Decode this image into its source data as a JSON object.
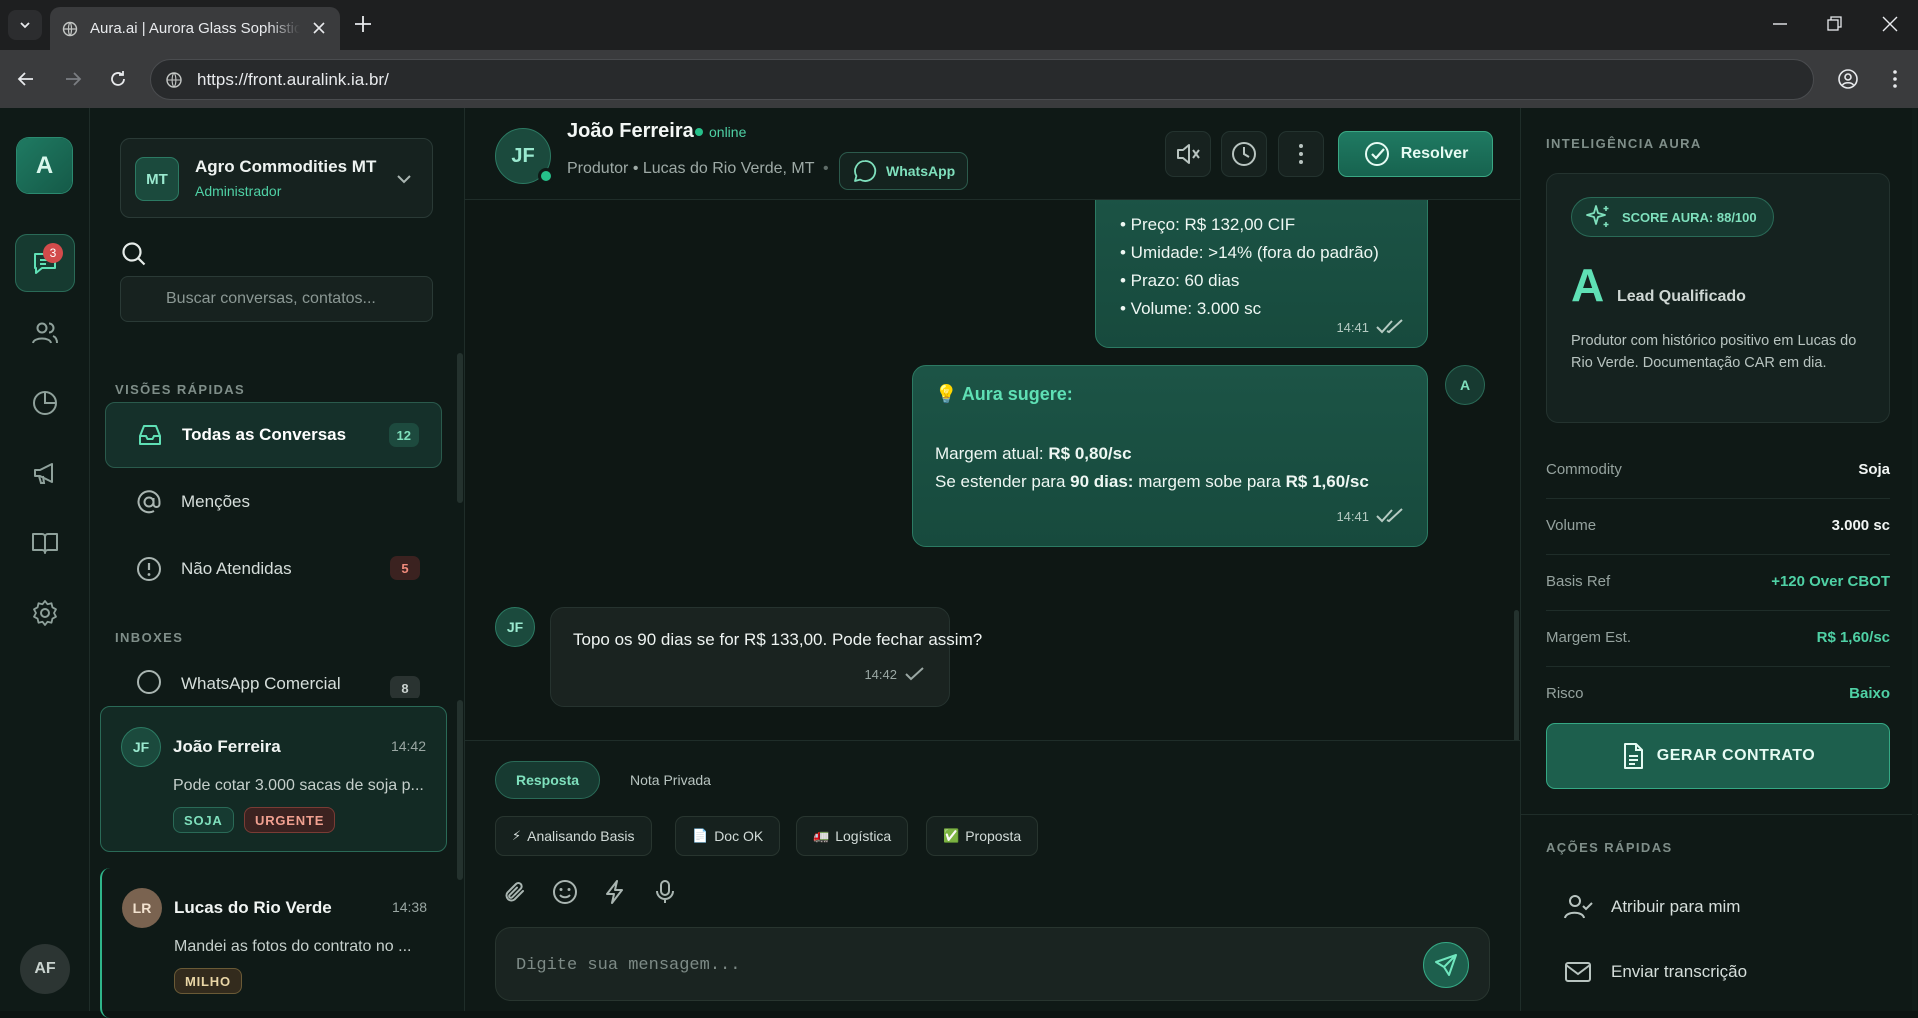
{
  "browser": {
    "tab_title": "Aura.ai | Aurora Glass Sophisticated",
    "url": "https://front.auralink.ia.br/"
  },
  "rail": {
    "logo": "A",
    "chat_badge": "3",
    "user_initials": "AF",
    "icons": [
      "chat-icon",
      "users-icon",
      "reports-icon",
      "campaigns-icon",
      "book-icon",
      "settings-icon"
    ]
  },
  "sidebar": {
    "org": {
      "initials": "MT",
      "name": "Agro Commodities MT",
      "role": "Administrador"
    },
    "search_placeholder": "Buscar conversas, contatos...",
    "quick_views_label": "VISÕES RÁPIDAS",
    "quick_views": [
      {
        "label": "Todas as Conversas",
        "count": "12"
      },
      {
        "label": "Menções",
        "count": ""
      },
      {
        "label": "Não Atendidas",
        "count": "5"
      }
    ],
    "inboxes_label": "INBOXES",
    "inboxes": [
      {
        "label": "WhatsApp Comercial",
        "count": "8"
      }
    ],
    "conversations": [
      {
        "initials": "JF",
        "name": "João Ferreira",
        "time": "14:42",
        "preview": "Pode cotar 3.000 sacas de soja p...",
        "tags": [
          "SOJA",
          "URGENTE"
        ]
      },
      {
        "initials": "LR",
        "name": "Lucas do Rio Verde",
        "time": "14:38",
        "preview": "Mandei as fotos do contrato no ...",
        "tags": [
          "MILHO"
        ]
      }
    ]
  },
  "chat": {
    "contact": {
      "initials": "JF",
      "name": "João Ferreira",
      "status": "online",
      "subtitle": "Produtor • Lucas do Rio Verde, MT",
      "separator": "•",
      "channel": "WhatsApp"
    },
    "resolve_label": "Resolver",
    "messages": {
      "m1": {
        "lines": [
          "• Preço: R$ 132,00 CIF",
          "• Umidade: >14% (fora do padrão)",
          "• Prazo: 60 dias",
          "• Volume: 3.000 sc"
        ],
        "time": "14:41"
      },
      "m2": {
        "avatar": "A",
        "title": "💡 Aura sugere:",
        "line1_a": "Margem atual: ",
        "line1_b": "R$ 0,80/sc",
        "line2_a": "Se estender para ",
        "line2_b": "90 dias:",
        "line2_c": " margem sobe para ",
        "line2_d": "R$ 1,60/sc",
        "time": "14:41"
      },
      "m3": {
        "avatar": "JF",
        "text": "Topo os 90 dias se for R$ 133,00. Pode fechar assim?",
        "time": "14:42"
      }
    },
    "composer": {
      "tabs": [
        "Resposta",
        "Nota Privada"
      ],
      "quick_chips": [
        {
          "emoji": "⚡",
          "label": "Analisando Basis"
        },
        {
          "emoji": "📄",
          "label": "Doc OK"
        },
        {
          "emoji": "🚛",
          "label": "Logística"
        },
        {
          "emoji": "✅",
          "label": "Proposta"
        }
      ],
      "placeholder": "Digite sua mensagem..."
    }
  },
  "right": {
    "intel_label": "INTELIGÊNCIA AURA",
    "score_label": "SCORE AURA: 88/100",
    "grade": "A",
    "grade_label": "Lead Qualificado",
    "description": "Produtor com histórico positivo em Lucas do Rio Verde. Documentação CAR em dia.",
    "fields": [
      {
        "key": "Commodity",
        "value": "Soja",
        "color": "#f1f5f3"
      },
      {
        "key": "Volume",
        "value": "3.000 sc",
        "color": "#f1f5f3"
      },
      {
        "key": "Basis Ref",
        "value": "+120 Over CBOT",
        "color": "#4fd1a5"
      },
      {
        "key": "Margem Est.",
        "value": "R$ 1,60/sc",
        "color": "#4fd1a5"
      },
      {
        "key": "Risco",
        "value": "Baixo",
        "color": "#4fd1a5"
      }
    ],
    "contract_button": "GERAR CONTRATO",
    "actions_label": "AÇÕES RÁPIDAS",
    "actions": [
      "Atribuir para mim",
      "Enviar transcrição"
    ]
  },
  "colors": {
    "accent": "#4fd1a5",
    "accent_dark": "#1d5f4d",
    "danger": "#d24b4b",
    "background": "#0d1513"
  }
}
